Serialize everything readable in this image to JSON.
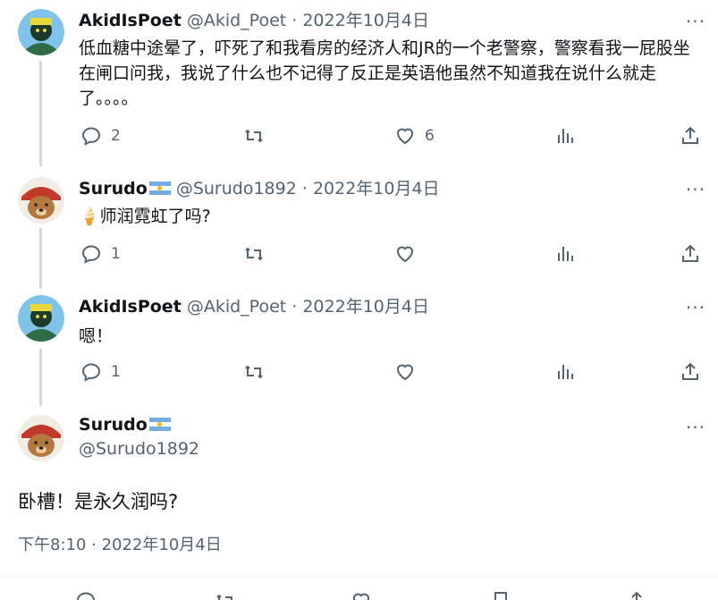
{
  "more_label": "···",
  "replies": [
    {
      "name": "AkidIsPoet",
      "handle": "@Akid_Poet",
      "date": "· 2022年10月4日",
      "avatar": "poet-avatar",
      "text": "低血糖中途晕了，吓死了和我看房的经济人和JR的一个老警察，警察看我一屁股坐在闸口问我，我说了什么也不记得了反正是英语他虽然不知道我在说什么就走了。。。。",
      "reply_count": "2",
      "retweet_count": "",
      "like_count": "6"
    },
    {
      "name": "Surudo",
      "handle": "@Surudo1892",
      "date": "· 2022年10月4日",
      "avatar": "bear-avatar",
      "flag": "argentina-flag",
      "text": "🍦师润霓虹了吗?",
      "reply_count": "1",
      "retweet_count": "",
      "like_count": ""
    },
    {
      "name": "AkidIsPoet",
      "handle": "@Akid_Poet",
      "date": "· 2022年10月4日",
      "avatar": "poet-avatar",
      "text": "嗯！",
      "reply_count": "1",
      "retweet_count": "",
      "like_count": ""
    }
  ],
  "main_tweet": {
    "name": "Surudo",
    "handle": "@Surudo1892",
    "text": "卧槽！是永久润吗?",
    "timestamp": "下午8:10 · 2022年10月4日",
    "avatar": "bear-avatar",
    "flag": "argentina-flag"
  }
}
